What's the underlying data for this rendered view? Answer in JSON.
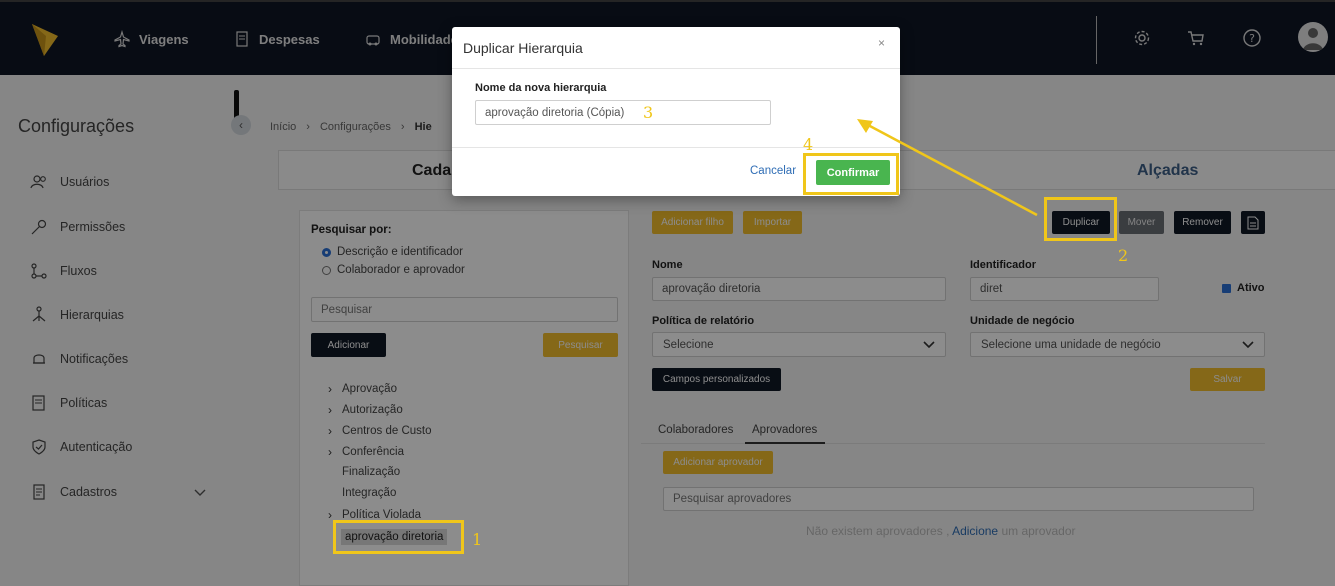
{
  "topbar": {
    "nav": [
      {
        "label": "Viagens",
        "icon": "plane-icon"
      },
      {
        "label": "Despesas",
        "icon": "receipt-icon"
      },
      {
        "label": "Mobilidade",
        "icon": "car-icon"
      }
    ],
    "icons": [
      "gear-icon",
      "cart-icon",
      "help-icon",
      "user-avatar-icon"
    ]
  },
  "sidebar": {
    "title": "Configurações",
    "items": [
      {
        "label": "Usuários",
        "icon": "users-icon"
      },
      {
        "label": "Permissões",
        "icon": "key-icon"
      },
      {
        "label": "Fluxos",
        "icon": "flow-icon"
      },
      {
        "label": "Hierarquias",
        "icon": "hierarchy-icon"
      },
      {
        "label": "Notificações",
        "icon": "bell-icon"
      },
      {
        "label": "Políticas",
        "icon": "policy-icon"
      },
      {
        "label": "Autenticação",
        "icon": "shield-icon"
      },
      {
        "label": "Cadastros",
        "icon": "document-icon"
      }
    ]
  },
  "breadcrumb": [
    "Início",
    "Configurações",
    "Hie"
  ],
  "tabs": {
    "cadastro": "Cada",
    "alcadas": "Alçadas"
  },
  "search": {
    "title": "Pesquisar por:",
    "option1": "Descrição e identificador",
    "option2": "Colaborador e aprovador",
    "placeholder": "Pesquisar",
    "add_label": "Adicionar",
    "search_label": "Pesquisar"
  },
  "tree": {
    "items": [
      "Aprovação",
      "Autorização",
      "Centros de Custo",
      "Conferência",
      "Finalização",
      "Integração",
      "Política Violada"
    ],
    "selected": "aprovação diretoria"
  },
  "toolbar": {
    "add_child": "Adicionar filho",
    "import": "Importar",
    "duplicate": "Duplicar",
    "move": "Mover",
    "remove": "Remover"
  },
  "form": {
    "name_label": "Nome",
    "name_value": "aprovação diretoria",
    "id_label": "Identificador",
    "id_value": "diret",
    "active_label": "Ativo",
    "policy_label": "Política de relatório",
    "policy_value": "Selecione",
    "unit_label": "Unidade de negócio",
    "unit_value": "Selecione uma unidade de negócio",
    "custom_fields": "Campos personalizados",
    "save": "Salvar"
  },
  "subtabs": {
    "collaborators": "Colaboradores",
    "approvers": "Aprovadores",
    "add_approver": "Adicionar aprovador",
    "search_placeholder": "Pesquisar aprovadores",
    "empty_prefix": "Não existem aprovadores ,",
    "empty_link": "Adicione",
    "empty_suffix": "um aprovador"
  },
  "modal": {
    "title": "Duplicar Hierarquia",
    "close": "×",
    "field_label": "Nome da nova hierarquia",
    "field_value": "aprovação diretoria (Cópia)",
    "cancel": "Cancelar",
    "confirm": "Confirmar"
  },
  "annotations": {
    "n1": "1",
    "n2": "2",
    "n3": "3",
    "n4": "4",
    "color": "#f0c61a"
  }
}
